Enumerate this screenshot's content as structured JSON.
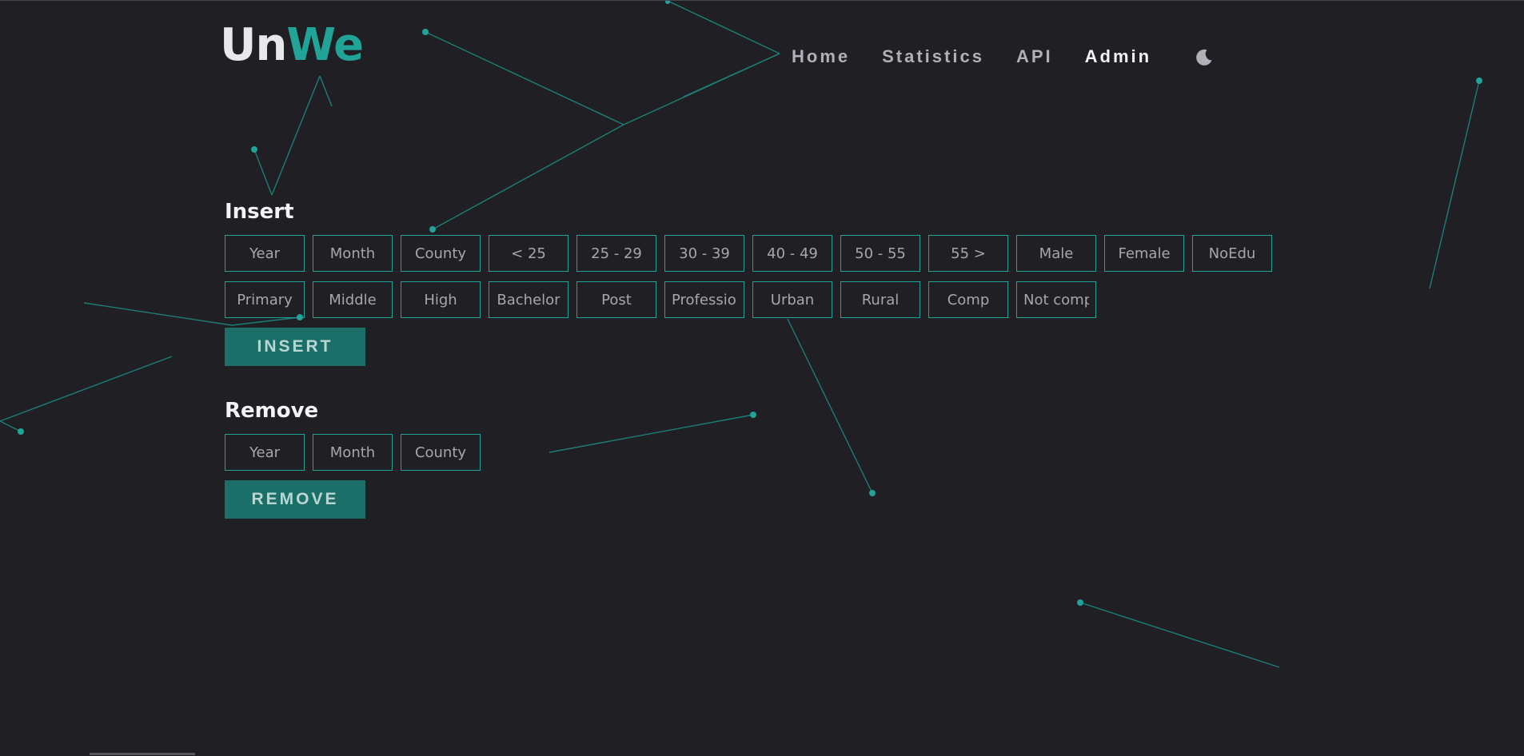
{
  "logo": {
    "part1": "Un",
    "part2": "We"
  },
  "nav": {
    "home": "Home",
    "statistics": "Statistics",
    "api": "API",
    "admin": "Admin"
  },
  "theme_toggle": {
    "icon": "moon-icon"
  },
  "insert": {
    "title": "Insert",
    "fields": [
      "Year",
      "Month",
      "County",
      "< 25",
      "25 - 29",
      "30 - 39",
      "40 - 49",
      "50 - 55",
      "55 >",
      "Male",
      "Female",
      "NoEdu",
      "Primary",
      "Middle",
      "High",
      "Bachelor",
      "Post",
      "Professional",
      "Urban",
      "Rural",
      "Comp",
      "Not comp"
    ],
    "button": "INSERT"
  },
  "remove": {
    "title": "Remove",
    "fields": [
      "Year",
      "Month",
      "County"
    ],
    "button": "REMOVE"
  },
  "colors": {
    "accent": "#21a397",
    "button": "#1c6e68",
    "background": "#1f1f24"
  }
}
